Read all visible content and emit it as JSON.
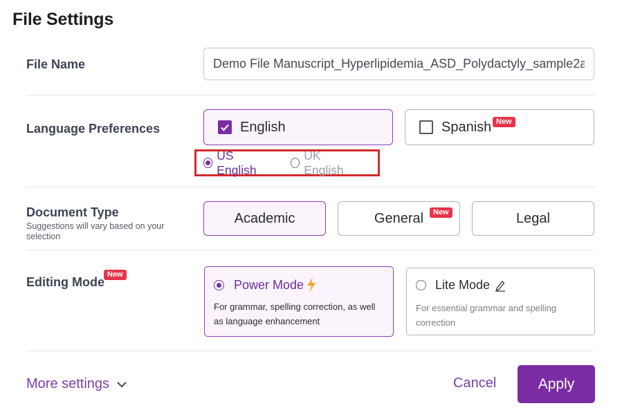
{
  "title": "File Settings",
  "file_name": {
    "label": "File Name",
    "value": "Demo File Manuscript_Hyperlipidemia_ASD_Polydactyly_sample2a"
  },
  "language": {
    "label": "Language Preferences",
    "options": [
      {
        "label": "English",
        "checked": true
      },
      {
        "label": "Spanish",
        "checked": false,
        "badge": "New"
      }
    ],
    "dialects": [
      {
        "label": "US English",
        "selected": true
      },
      {
        "label": "UK English",
        "selected": false
      }
    ]
  },
  "document_type": {
    "label": "Document Type",
    "sublabel": "Suggestions will vary based on your selection",
    "options": [
      {
        "label": "Academic",
        "selected": true
      },
      {
        "label": "General",
        "selected": false,
        "badge": "New"
      },
      {
        "label": "Legal",
        "selected": false
      }
    ]
  },
  "editing_mode": {
    "label": "Editing Mode",
    "badge": "New",
    "options": [
      {
        "label": "Power Mode",
        "icon": "lightning-icon",
        "description": "For grammar, spelling correction, as well as language enhancement",
        "selected": true
      },
      {
        "label": "Lite Mode",
        "icon": "pencil-icon",
        "description": "For essential grammar and spelling correction",
        "selected": false
      }
    ]
  },
  "footer": {
    "more_settings": "More settings",
    "cancel": "Cancel",
    "apply": "Apply"
  },
  "colors": {
    "accent": "#7b2ca4",
    "badge": "#e8334a",
    "highlight_border": "#d12b2b"
  }
}
